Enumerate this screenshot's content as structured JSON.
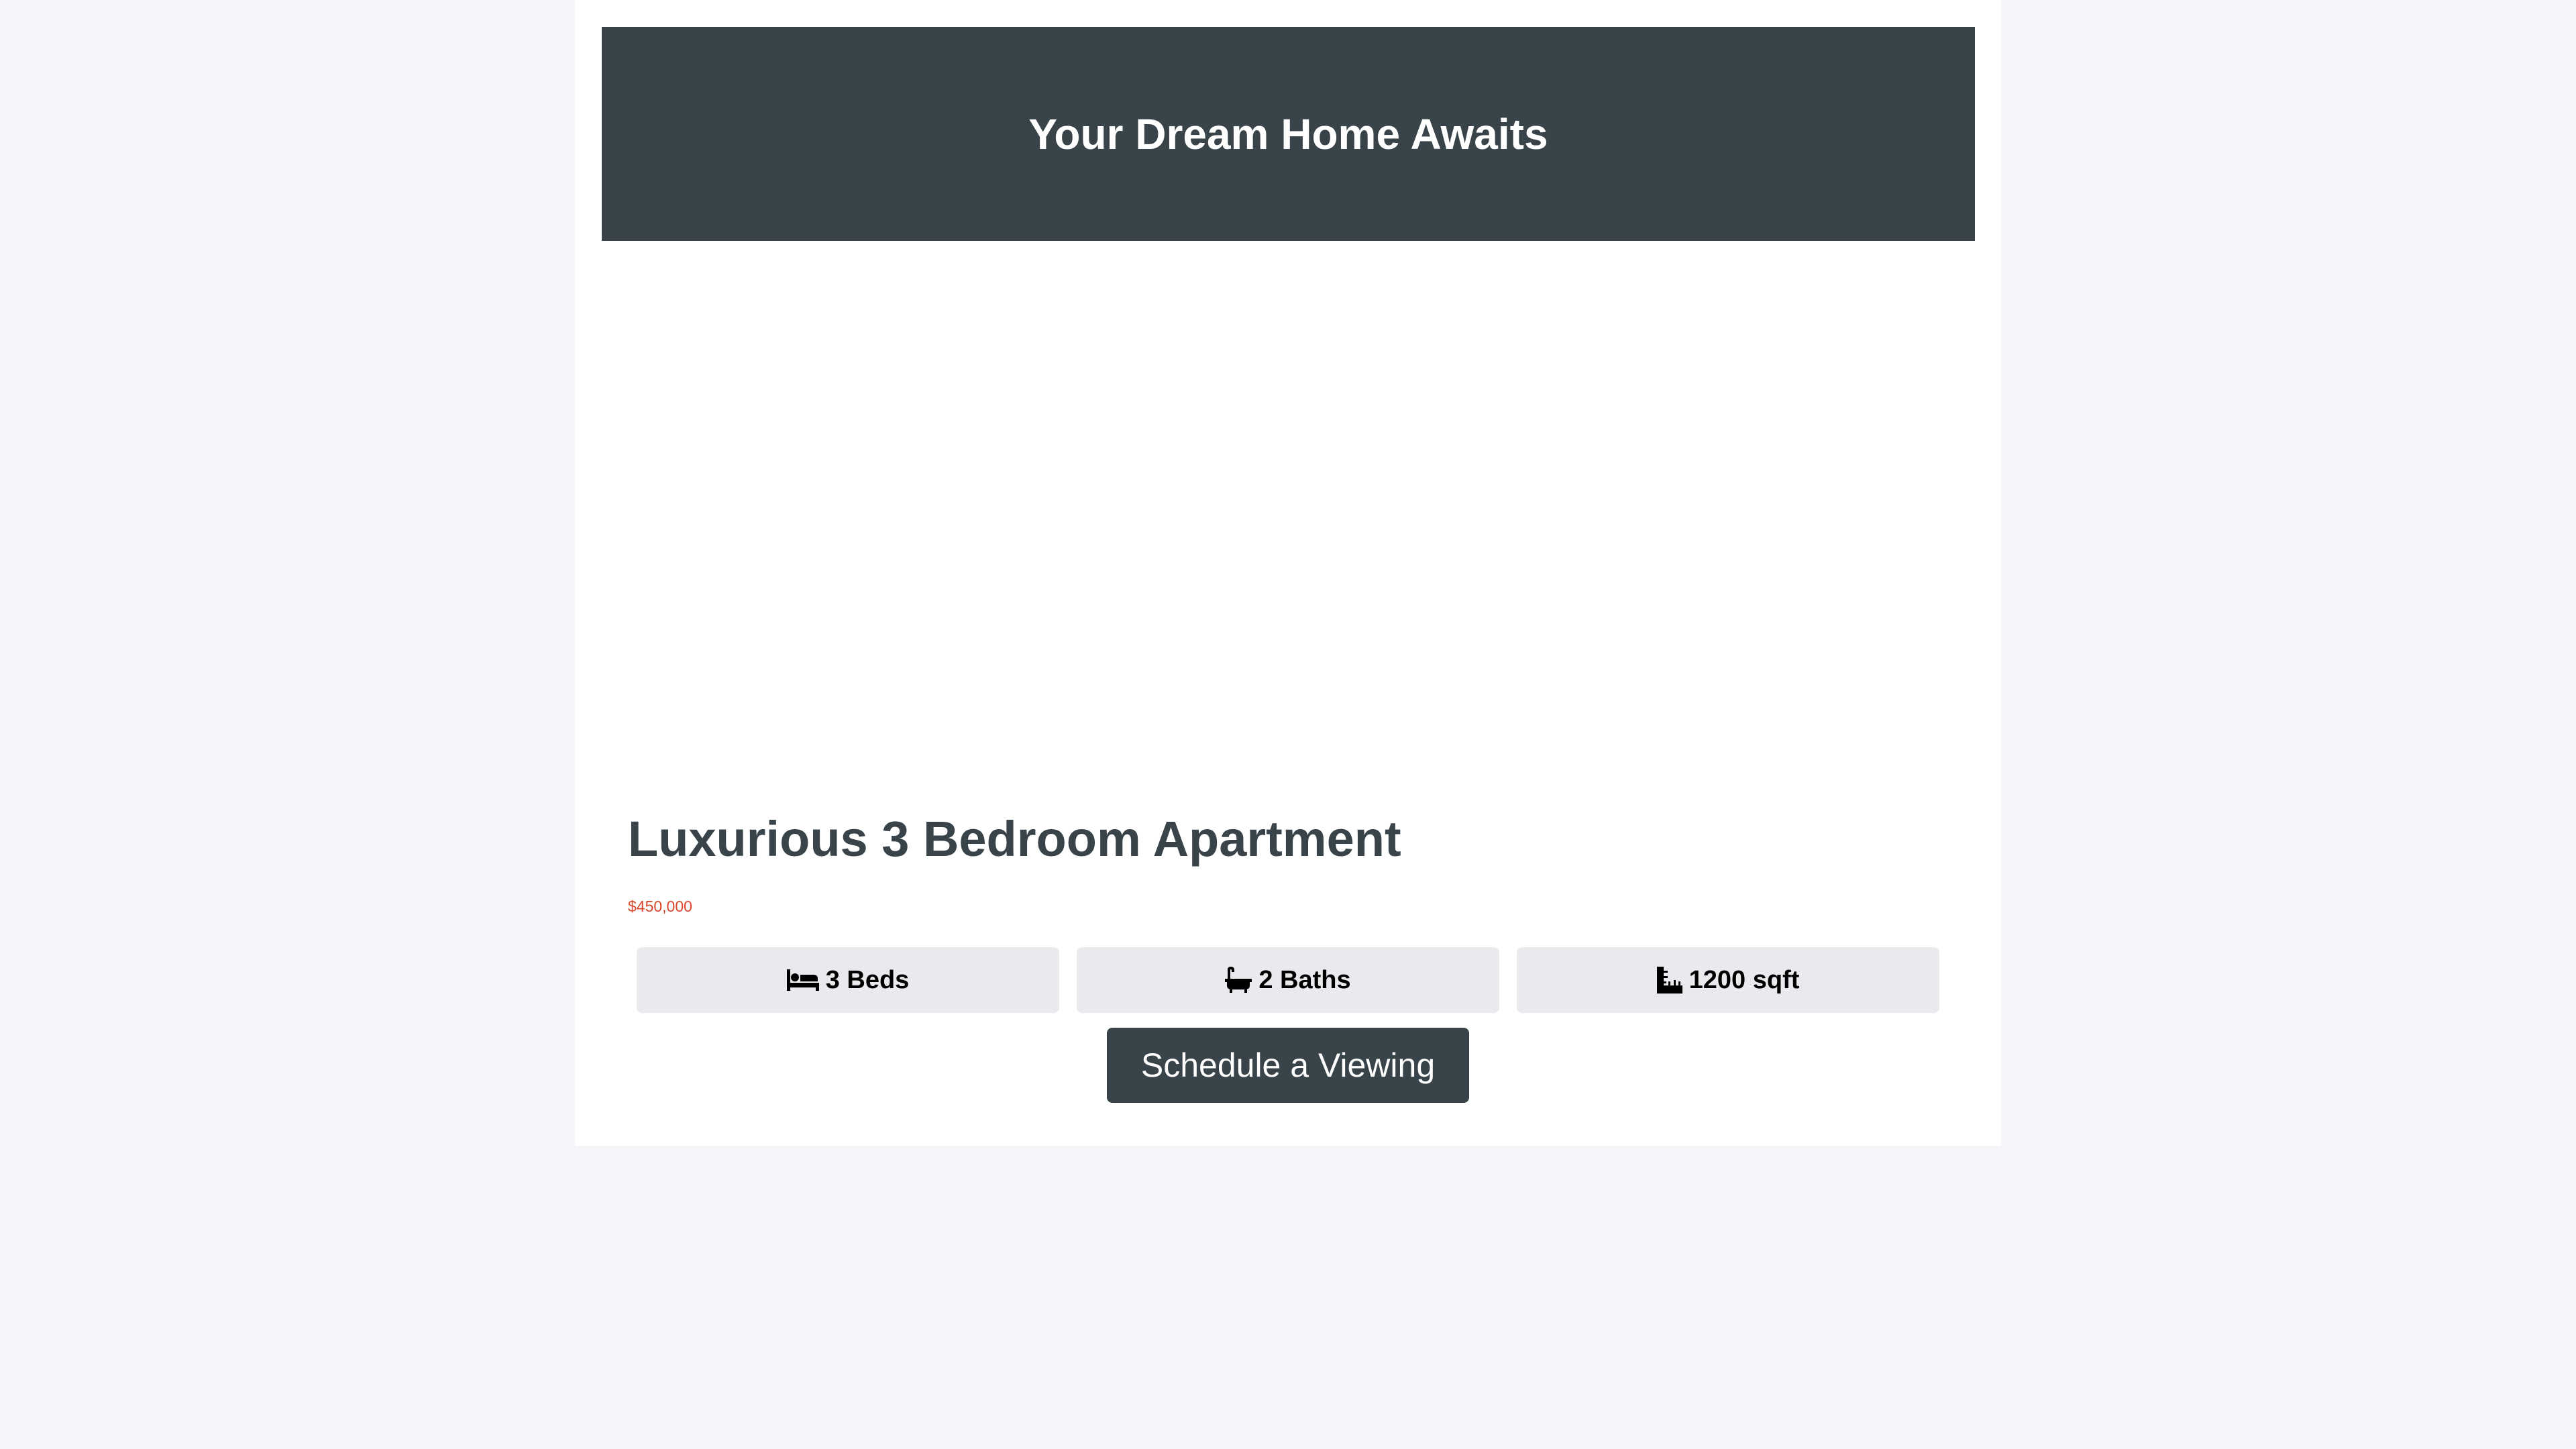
{
  "header": {
    "title": "Your Dream Home Awaits"
  },
  "listing": {
    "title": "Luxurious 3 Bedroom Apartment",
    "price": "$450,000",
    "features": [
      {
        "icon": "bed-icon",
        "label": "3 Beds"
      },
      {
        "icon": "bath-icon",
        "label": "2 Baths"
      },
      {
        "icon": "ruler-icon",
        "label": "1200 sqft"
      }
    ],
    "cta_label": "Schedule a Viewing"
  },
  "colors": {
    "page_background": "#f4f5f8",
    "card_background": "#ffffff",
    "primary_dark": "#39434a",
    "price_accent": "#d9472b",
    "feature_background": "#e9eaed"
  }
}
